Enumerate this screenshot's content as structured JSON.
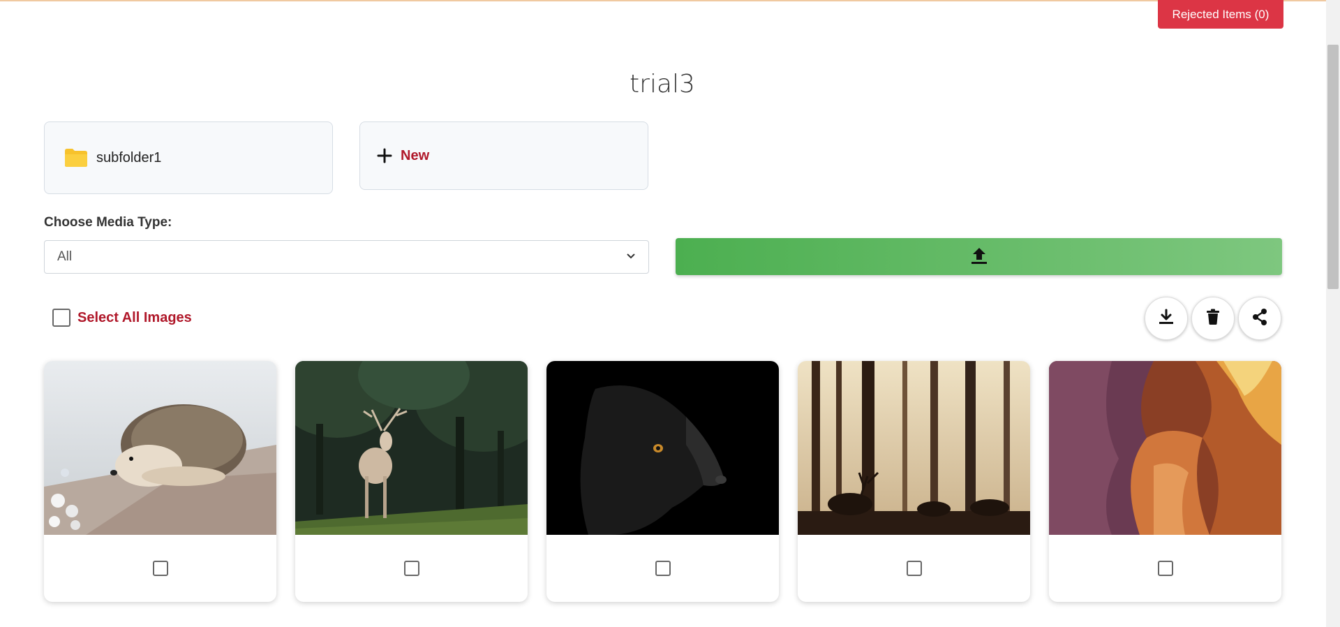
{
  "header": {
    "rejected_label": "Rejected Items (0)"
  },
  "page": {
    "title": "trial3"
  },
  "folders": [
    {
      "name": "subfolder1",
      "icon": "folder-icon"
    }
  ],
  "new_folder": {
    "label": "New",
    "icon": "plus-icon"
  },
  "media_type": {
    "label": "Choose Media Type:",
    "selected": "All"
  },
  "upload": {
    "icon": "upload-icon",
    "color_from": "#4caf50",
    "color_to": "#7ec77f"
  },
  "selection": {
    "select_all_label": "Select All Images"
  },
  "actions": [
    {
      "name": "download-button",
      "icon": "download-icon"
    },
    {
      "name": "delete-button",
      "icon": "trash-icon"
    },
    {
      "name": "share-button",
      "icon": "share-icon"
    }
  ],
  "images": [
    {
      "subject": "hedgehog"
    },
    {
      "subject": "deer"
    },
    {
      "subject": "dog"
    },
    {
      "subject": "forest-silhouette"
    },
    {
      "subject": "canyon"
    }
  ],
  "colors": {
    "accent": "#b0182a",
    "danger": "#dc3545",
    "folder": "#f7c22c"
  }
}
